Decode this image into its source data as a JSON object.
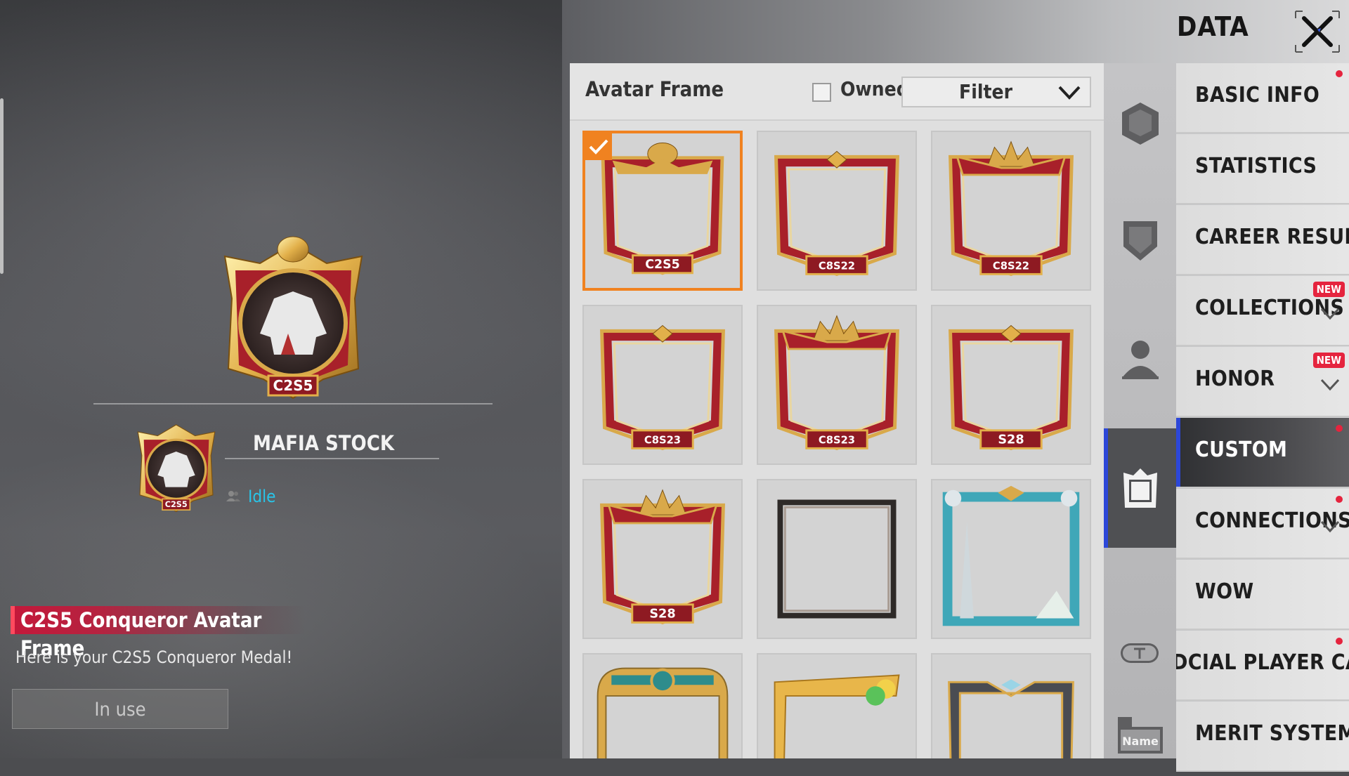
{
  "header": {
    "title": "DATA",
    "close_icon": "close-icon"
  },
  "profile": {
    "player_name": "MAFIA STOCK",
    "status": "Idle",
    "medal_text": "C2S5"
  },
  "selected_item": {
    "title": "C2S5 Conqueror Avatar Frame",
    "description": "Here is your C2S5 Conqueror Medal!",
    "button_label": "In use"
  },
  "panel": {
    "title": "Avatar Frame",
    "owned_label": "Owned",
    "owned_checked": false,
    "filter_label": "Filter",
    "frames": [
      {
        "tag": "C2S5",
        "style": "conqueror",
        "selected": true
      },
      {
        "tag": "C8S22",
        "style": "ace"
      },
      {
        "tag": "C8S22",
        "style": "crown"
      },
      {
        "tag": "C8S23",
        "style": "ace"
      },
      {
        "tag": "C8S23",
        "style": "crown"
      },
      {
        "tag": "S28",
        "style": "ace"
      },
      {
        "tag": "S28",
        "style": "crown"
      },
      {
        "tag": "",
        "style": "plain"
      },
      {
        "tag": "",
        "style": "tower"
      },
      {
        "tag": "",
        "style": "teal-gold"
      },
      {
        "tag": "",
        "style": "party"
      },
      {
        "tag": "",
        "style": "dark-metal"
      }
    ]
  },
  "side_icons": [
    {
      "name": "hexagon-badge-icon",
      "active": false
    },
    {
      "name": "shield-icon",
      "active": false
    },
    {
      "name": "person-icon",
      "active": false
    },
    {
      "name": "avatar-frame-icon",
      "active": true
    },
    {
      "name": "title-badge-icon",
      "active": false
    },
    {
      "name": "nameplate-icon",
      "active": false,
      "text": "Name"
    }
  ],
  "menu": [
    {
      "label": "BASIC INFO",
      "dot": true
    },
    {
      "label": "STATISTICS"
    },
    {
      "label": "CAREER RESULTS"
    },
    {
      "label": "COLLECTIONS",
      "badge": "NEW",
      "chevron": true
    },
    {
      "label": "HONOR",
      "badge": "NEW",
      "chevron": true
    },
    {
      "label": "CUSTOM",
      "dot": true,
      "active": true
    },
    {
      "label": "CONNECTIONS",
      "dot": true,
      "chevron": true
    },
    {
      "label": "WOW"
    },
    {
      "label": "DCIAL PLAYER CARD",
      "dot": true
    },
    {
      "label": "MERIT SYSTEM"
    }
  ],
  "colors": {
    "accent_orange": "#f08220",
    "active_blue": "#2c47d8",
    "status_cyan": "#29c4e8",
    "badge_red": "#e5243e",
    "frame_red": "#a8202a",
    "frame_gold": "#d9a94a"
  }
}
